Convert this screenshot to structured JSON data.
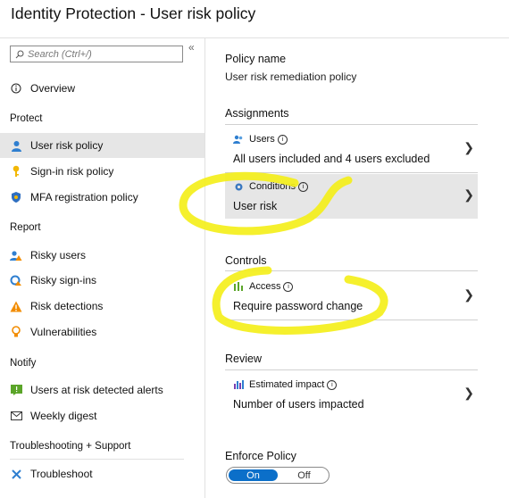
{
  "title": "Identity Protection - User risk policy",
  "collapse_glyph": "«",
  "search": {
    "placeholder": "Search (Ctrl+/)"
  },
  "nav": {
    "overview": "Overview",
    "sections": {
      "protect": "Protect",
      "report": "Report",
      "notify": "Notify",
      "troubleshooting": "Troubleshooting + Support"
    },
    "items": [
      {
        "label": "User risk policy",
        "icon": "user-icon",
        "active": true
      },
      {
        "label": "Sign-in risk policy",
        "icon": "key-icon"
      },
      {
        "label": "MFA registration policy",
        "icon": "shield-icon"
      },
      {
        "label": "Risky users",
        "icon": "risky-user-icon"
      },
      {
        "label": "Risky sign-ins",
        "icon": "risky-signin-icon"
      },
      {
        "label": "Risk detections",
        "icon": "warning-icon"
      },
      {
        "label": "Vulnerabilities",
        "icon": "lightbulb-icon"
      },
      {
        "label": "Users at risk detected alerts",
        "icon": "alert-icon"
      },
      {
        "label": "Weekly digest",
        "icon": "mail-icon"
      },
      {
        "label": "Troubleshoot",
        "icon": "wrench-icon"
      }
    ]
  },
  "main": {
    "policy_name_label": "Policy name",
    "policy_name_value": "User risk remediation policy",
    "assignments_label": "Assignments",
    "users": {
      "title": "Users",
      "value": "All users included and 4 users excluded"
    },
    "conditions": {
      "title": "Conditions",
      "value": "User risk"
    },
    "controls_label": "Controls",
    "access": {
      "title": "Access",
      "value": "Require password change"
    },
    "review_label": "Review",
    "impact": {
      "title": "Estimated impact",
      "value": "Number of users impacted"
    },
    "enforce_label": "Enforce Policy",
    "toggle": {
      "on": "On",
      "off": "Off",
      "selected": "On"
    }
  },
  "colors": {
    "accent": "#0b6fc9",
    "highlight": "#f4ef1b",
    "active_bg": "#e6e6e6"
  }
}
